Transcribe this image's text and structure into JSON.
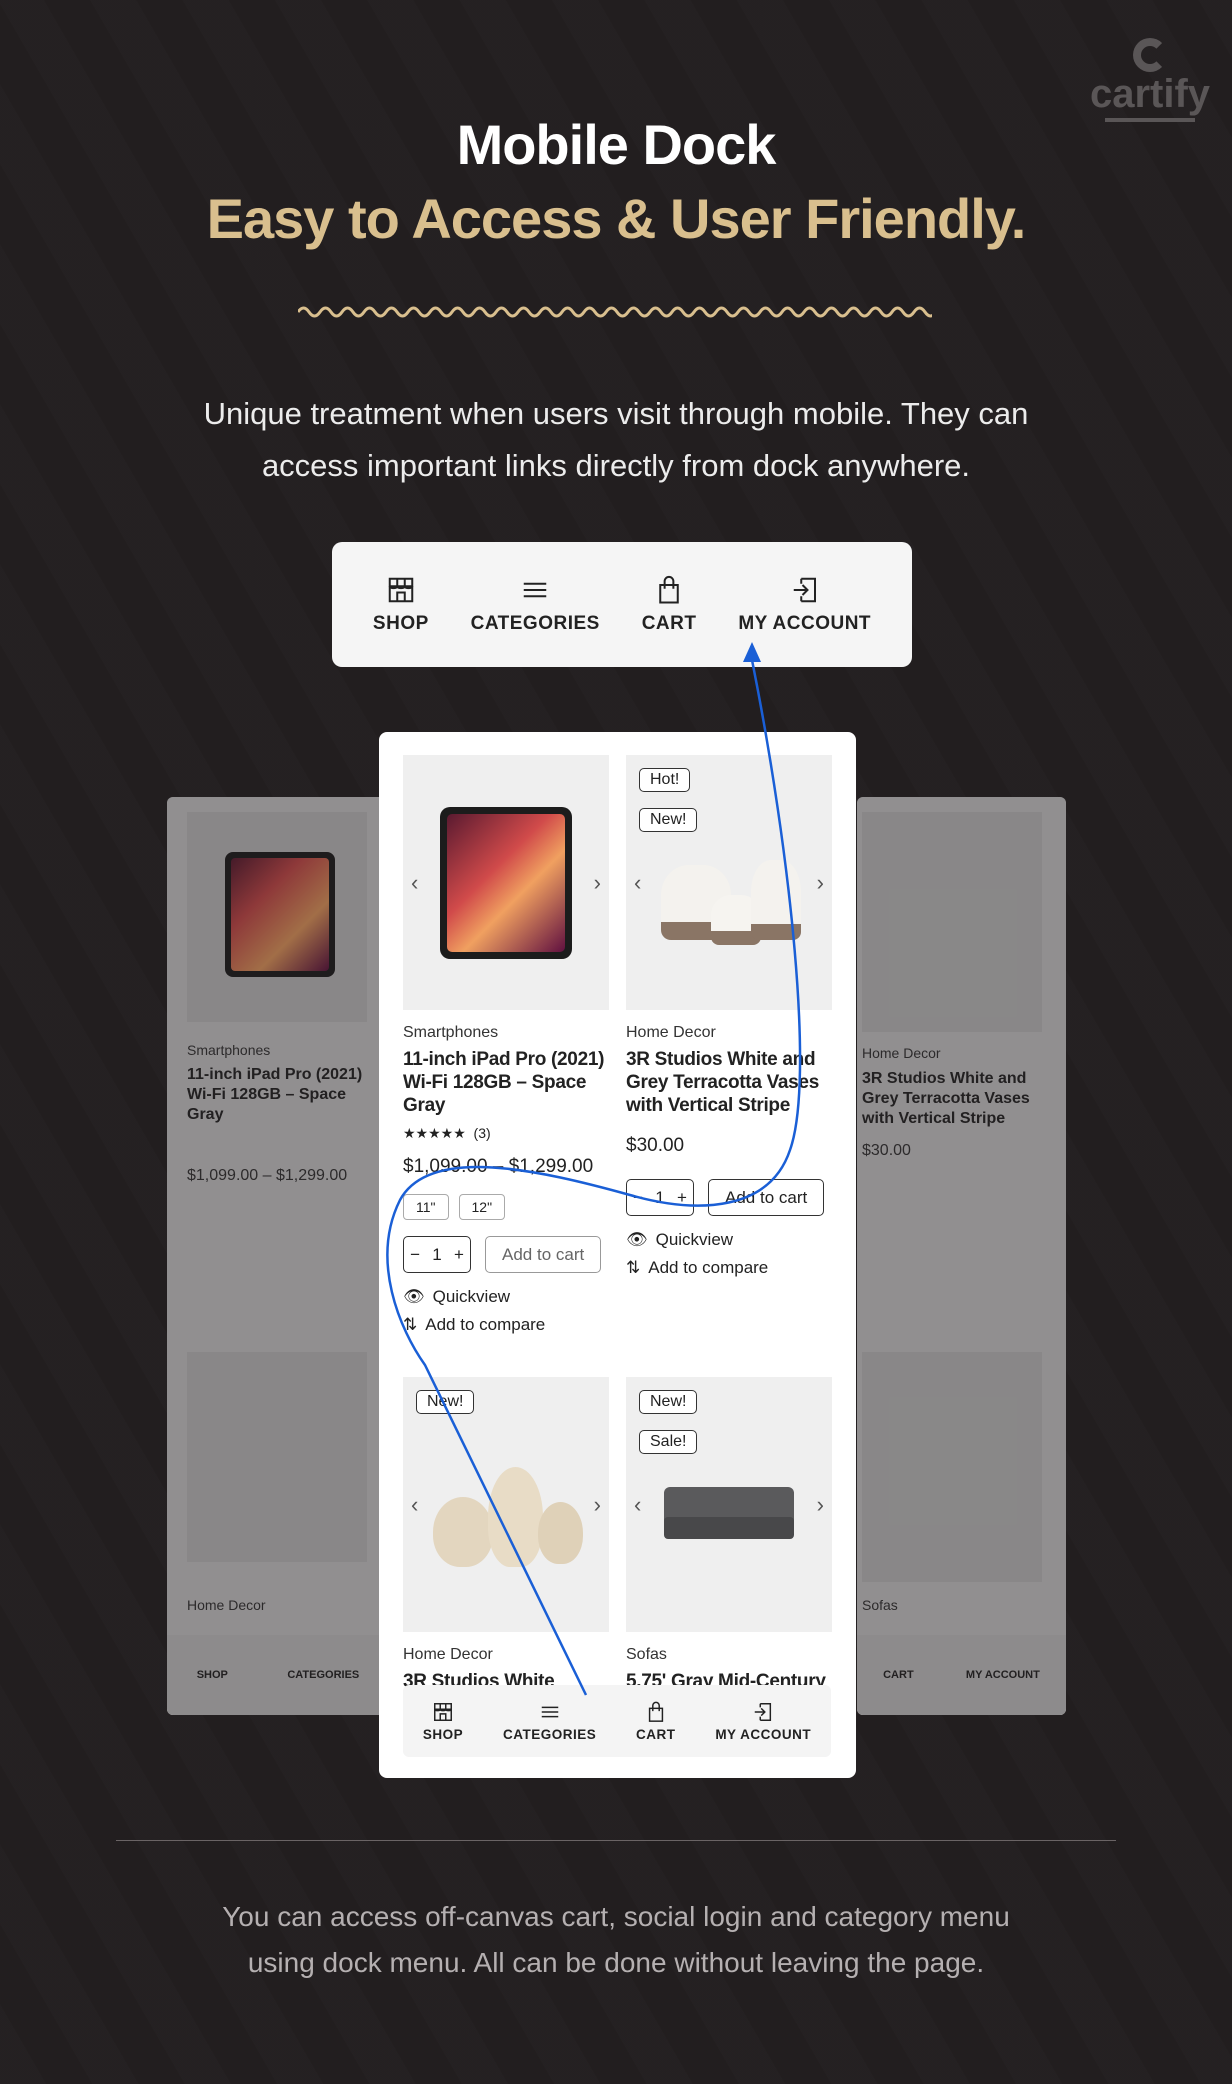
{
  "brand": {
    "logo_text": "cartify"
  },
  "header": {
    "title": "Mobile Dock",
    "subtitle": "Easy to Access & User Friendly.",
    "description_line1": "Unique treatment when users visit through mobile. They can",
    "description_line2": "access important links directly from dock anywhere."
  },
  "dock": {
    "items": [
      {
        "label": "SHOP",
        "icon": "shop-icon"
      },
      {
        "label": "CATEGORIES",
        "icon": "menu-icon"
      },
      {
        "label": "CART",
        "icon": "bag-icon"
      },
      {
        "label": "MY ACCOUNT",
        "icon": "login-icon"
      }
    ]
  },
  "products": [
    {
      "category": "Smartphones",
      "title": "11-inch iPad Pro (2021) Wi-Fi 128GB – Space Gray",
      "rating": "★★★★★",
      "reviews": "(3)",
      "price": "$1,099.00 – $1,299.00",
      "options": [
        "11\"",
        "12\""
      ],
      "qty": "1",
      "add_to_cart": "Add to cart",
      "quickview": "Quickview",
      "compare": "Add to compare"
    },
    {
      "category": "Home Decor",
      "badges": [
        "Hot!",
        "New!"
      ],
      "title": "3R Studios White and Grey Terracotta Vases with Vertical Stripe",
      "price": "$30.00",
      "qty": "1",
      "add_to_cart": "Add to cart",
      "quickview": "Quickview",
      "compare": "Add to compare"
    },
    {
      "category": "Home Decor",
      "badges": [
        "New!"
      ],
      "title": "3R Studios White"
    },
    {
      "category": "Sofas",
      "badges": [
        "New!",
        "Sale!"
      ],
      "title": "5.75' Gray Mid-Century"
    }
  ],
  "footer": {
    "line1": "You can access off-canvas cart, social login and category menu",
    "line2": "using dock menu. All can be done without leaving the page."
  },
  "colors": {
    "background": "#221e1f",
    "accent": "#d9bf8e",
    "annotation": "#1a5fd6"
  }
}
